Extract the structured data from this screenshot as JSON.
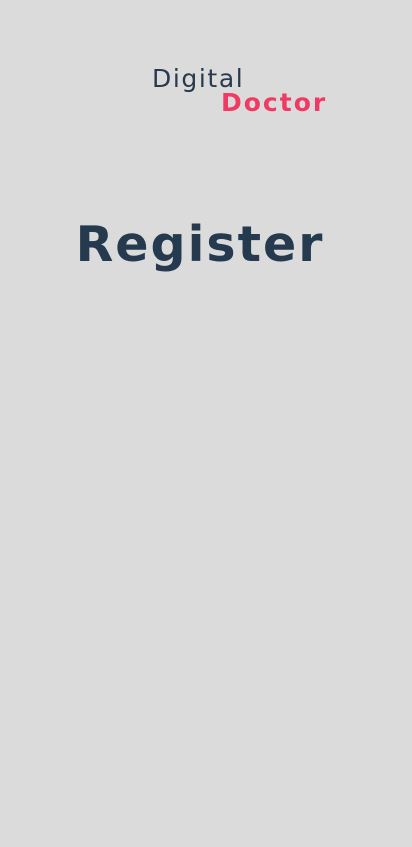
{
  "logo": {
    "primary": "Digital",
    "secondary": "Doctor"
  },
  "page": {
    "title": "Register"
  },
  "colors": {
    "background": "#dbdbdb",
    "primary_text": "#25394f",
    "accent": "#ef3b63"
  }
}
